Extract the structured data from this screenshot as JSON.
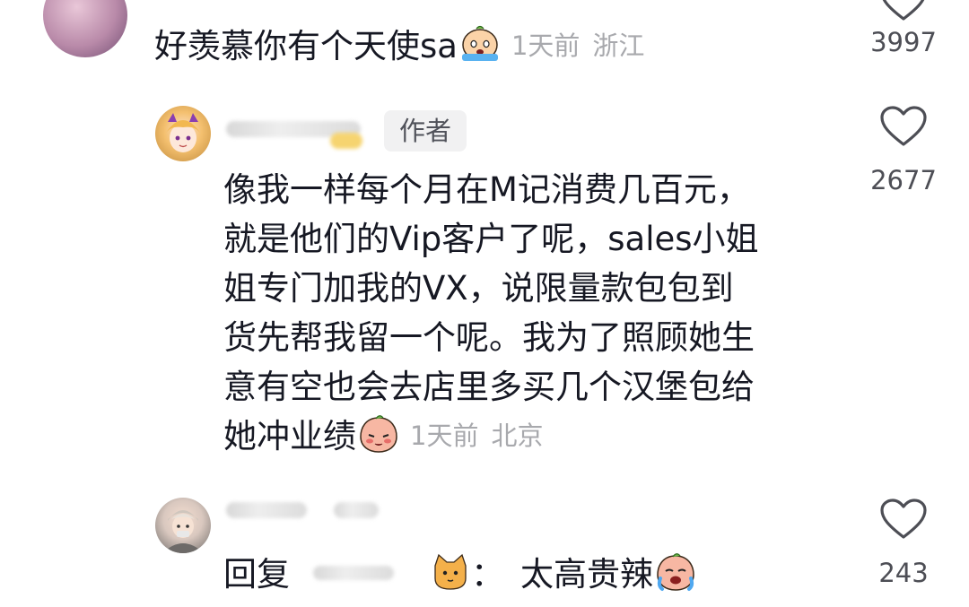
{
  "comments": [
    {
      "text": "好羡慕你有个天使sa",
      "emoji": "crying-face-emoji",
      "time": "1天前",
      "location": "浙江",
      "likes": "3997"
    },
    {
      "author_badge": "作者",
      "lines": [
        "像我一样每个月在M记消费几百元，",
        "就是他们的Vip客户了呢，sales小姐",
        "姐专门加我的VX，说限量款包包到",
        "货先帮我留一个呢。我为了照顾她生",
        "意有空也会去店里多买几个汉堡包给",
        "她冲业绩"
      ],
      "emoji": "shy-peach-emoji",
      "time": "1天前",
      "location": "北京",
      "likes": "2677"
    },
    {
      "reply_prefix": "回复",
      "reply_sep": "：",
      "text": "太高贵辣",
      "emoji": "crying-peach-emoji",
      "likes": "243"
    }
  ],
  "colors": {
    "text": "#161823",
    "meta": "#a8a9ad",
    "badge_bg": "#f1f1f2",
    "icon": "#4d4e55"
  }
}
